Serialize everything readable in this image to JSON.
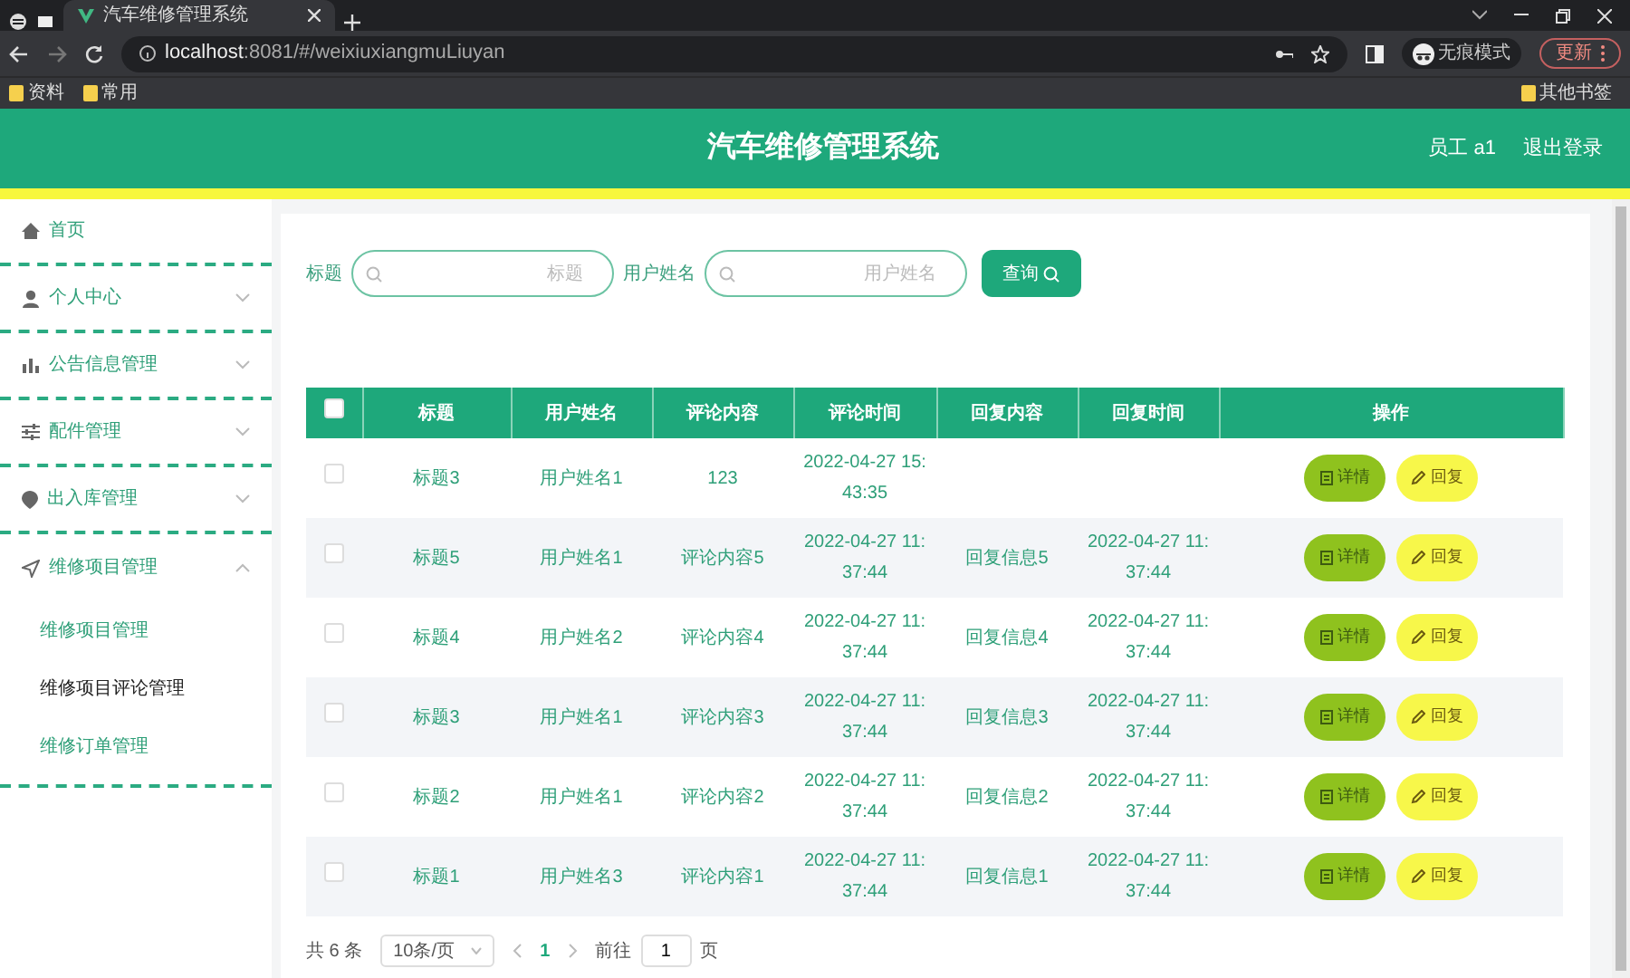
{
  "browser": {
    "tab_title": "汽车维修管理系统",
    "url_host": "localhost",
    "url_rest": ":8081/#/weixiuxiangmuLiuyan",
    "incognito_label": "无痕模式",
    "update_label": "更新",
    "bookmarks": [
      "资料",
      "常用"
    ],
    "other_bookmarks": "其他书签"
  },
  "header": {
    "title": "汽车维修管理系统",
    "user": "员工 a1",
    "logout": "退出登录"
  },
  "sidebar": {
    "items": [
      {
        "label": "首页",
        "kind": "link",
        "selected": false
      },
      {
        "label": "个人中心",
        "kind": "menu",
        "expanded": false
      },
      {
        "label": "公告信息管理",
        "kind": "menu",
        "expanded": false
      },
      {
        "label": "配件管理",
        "kind": "menu",
        "expanded": false
      },
      {
        "label": "出入库管理",
        "kind": "menu",
        "expanded": false
      },
      {
        "label": "维修项目管理",
        "kind": "menu",
        "expanded": true,
        "children": [
          {
            "label": "维修项目管理",
            "selected": false
          },
          {
            "label": "维修项目评论管理",
            "selected": true
          },
          {
            "label": "维修订单管理",
            "selected": false
          }
        ]
      }
    ]
  },
  "search": {
    "fields": [
      {
        "label": "标题",
        "placeholder": "标题"
      },
      {
        "label": "用户姓名",
        "placeholder": "用户姓名"
      }
    ],
    "button": "查询"
  },
  "table": {
    "select_all_checked": false,
    "columns": [
      "标题",
      "用户姓名",
      "评论内容",
      "评论时间",
      "回复内容",
      "回复时间",
      "操作"
    ],
    "rows": [
      {
        "checked": false,
        "cells": [
          "标题3",
          "用户姓名1",
          "123",
          "2022-04-27 15:43:35",
          "",
          ""
        ],
        "actions": [
          {
            "kind": "detail",
            "label": "详情"
          },
          {
            "kind": "reply",
            "label": "回复"
          }
        ]
      },
      {
        "checked": false,
        "cells": [
          "标题5",
          "用户姓名1",
          "评论内容5",
          "2022-04-27 11:37:44",
          "回复信息5",
          "2022-04-27 11:37:44"
        ],
        "actions": [
          {
            "kind": "detail",
            "label": "详情"
          },
          {
            "kind": "reply",
            "label": "回复"
          }
        ]
      },
      {
        "checked": false,
        "cells": [
          "标题4",
          "用户姓名2",
          "评论内容4",
          "2022-04-27 11:37:44",
          "回复信息4",
          "2022-04-27 11:37:44"
        ],
        "actions": [
          {
            "kind": "detail",
            "label": "详情"
          },
          {
            "kind": "reply",
            "label": "回复"
          }
        ]
      },
      {
        "checked": false,
        "cells": [
          "标题3",
          "用户姓名1",
          "评论内容3",
          "2022-04-27 11:37:44",
          "回复信息3",
          "2022-04-27 11:37:44"
        ],
        "actions": [
          {
            "kind": "detail",
            "label": "详情"
          },
          {
            "kind": "reply",
            "label": "回复"
          }
        ]
      },
      {
        "checked": false,
        "cells": [
          "标题2",
          "用户姓名1",
          "评论内容2",
          "2022-04-27 11:37:44",
          "回复信息2",
          "2022-04-27 11:37:44"
        ],
        "actions": [
          {
            "kind": "detail",
            "label": "详情"
          },
          {
            "kind": "reply",
            "label": "回复"
          }
        ]
      },
      {
        "checked": false,
        "cells": [
          "标题1",
          "用户姓名3",
          "评论内容1",
          "2022-04-27 11:37:44",
          "回复信息1",
          "2022-04-27 11:37:44"
        ],
        "actions": [
          {
            "kind": "detail",
            "label": "详情"
          },
          {
            "kind": "reply",
            "label": "回复"
          }
        ]
      }
    ]
  },
  "pagination": {
    "total": "共 6 条",
    "page_size": "10条/页",
    "pages": [
      {
        "label": "1",
        "selected": true
      }
    ],
    "goto_label": "前往",
    "goto_value": "1",
    "goto_suffix": "页"
  }
}
